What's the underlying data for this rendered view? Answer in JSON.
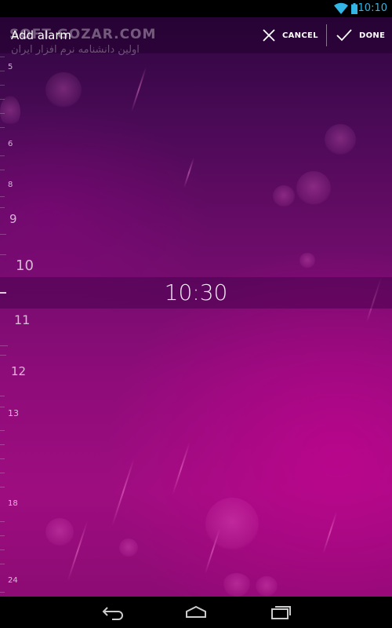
{
  "status_bar": {
    "time": "10:10",
    "icons": [
      "wifi-icon",
      "battery-icon"
    ],
    "accent_color": "#33b5e5"
  },
  "watermark": {
    "text": "SOFT GOZAR.COM",
    "subtitle": "اولین دانشنامه نرم افزار ایران"
  },
  "action_bar": {
    "title": "Add alarm",
    "cancel_label": "CANCEL",
    "done_label": "DONE",
    "cancel_icon": "close-icon",
    "done_icon": "check-icon"
  },
  "time_ruler": {
    "labels": [
      "5",
      "6",
      "8",
      "9",
      "10",
      "11",
      "12",
      "13",
      "18",
      "24"
    ]
  },
  "selected_time": "10:30",
  "nav_bar": {
    "icons": [
      "back-icon",
      "home-icon",
      "recent-apps-icon"
    ]
  },
  "colors": {
    "background_top": "#2e0640",
    "background_bottom": "#9e0d80"
  }
}
